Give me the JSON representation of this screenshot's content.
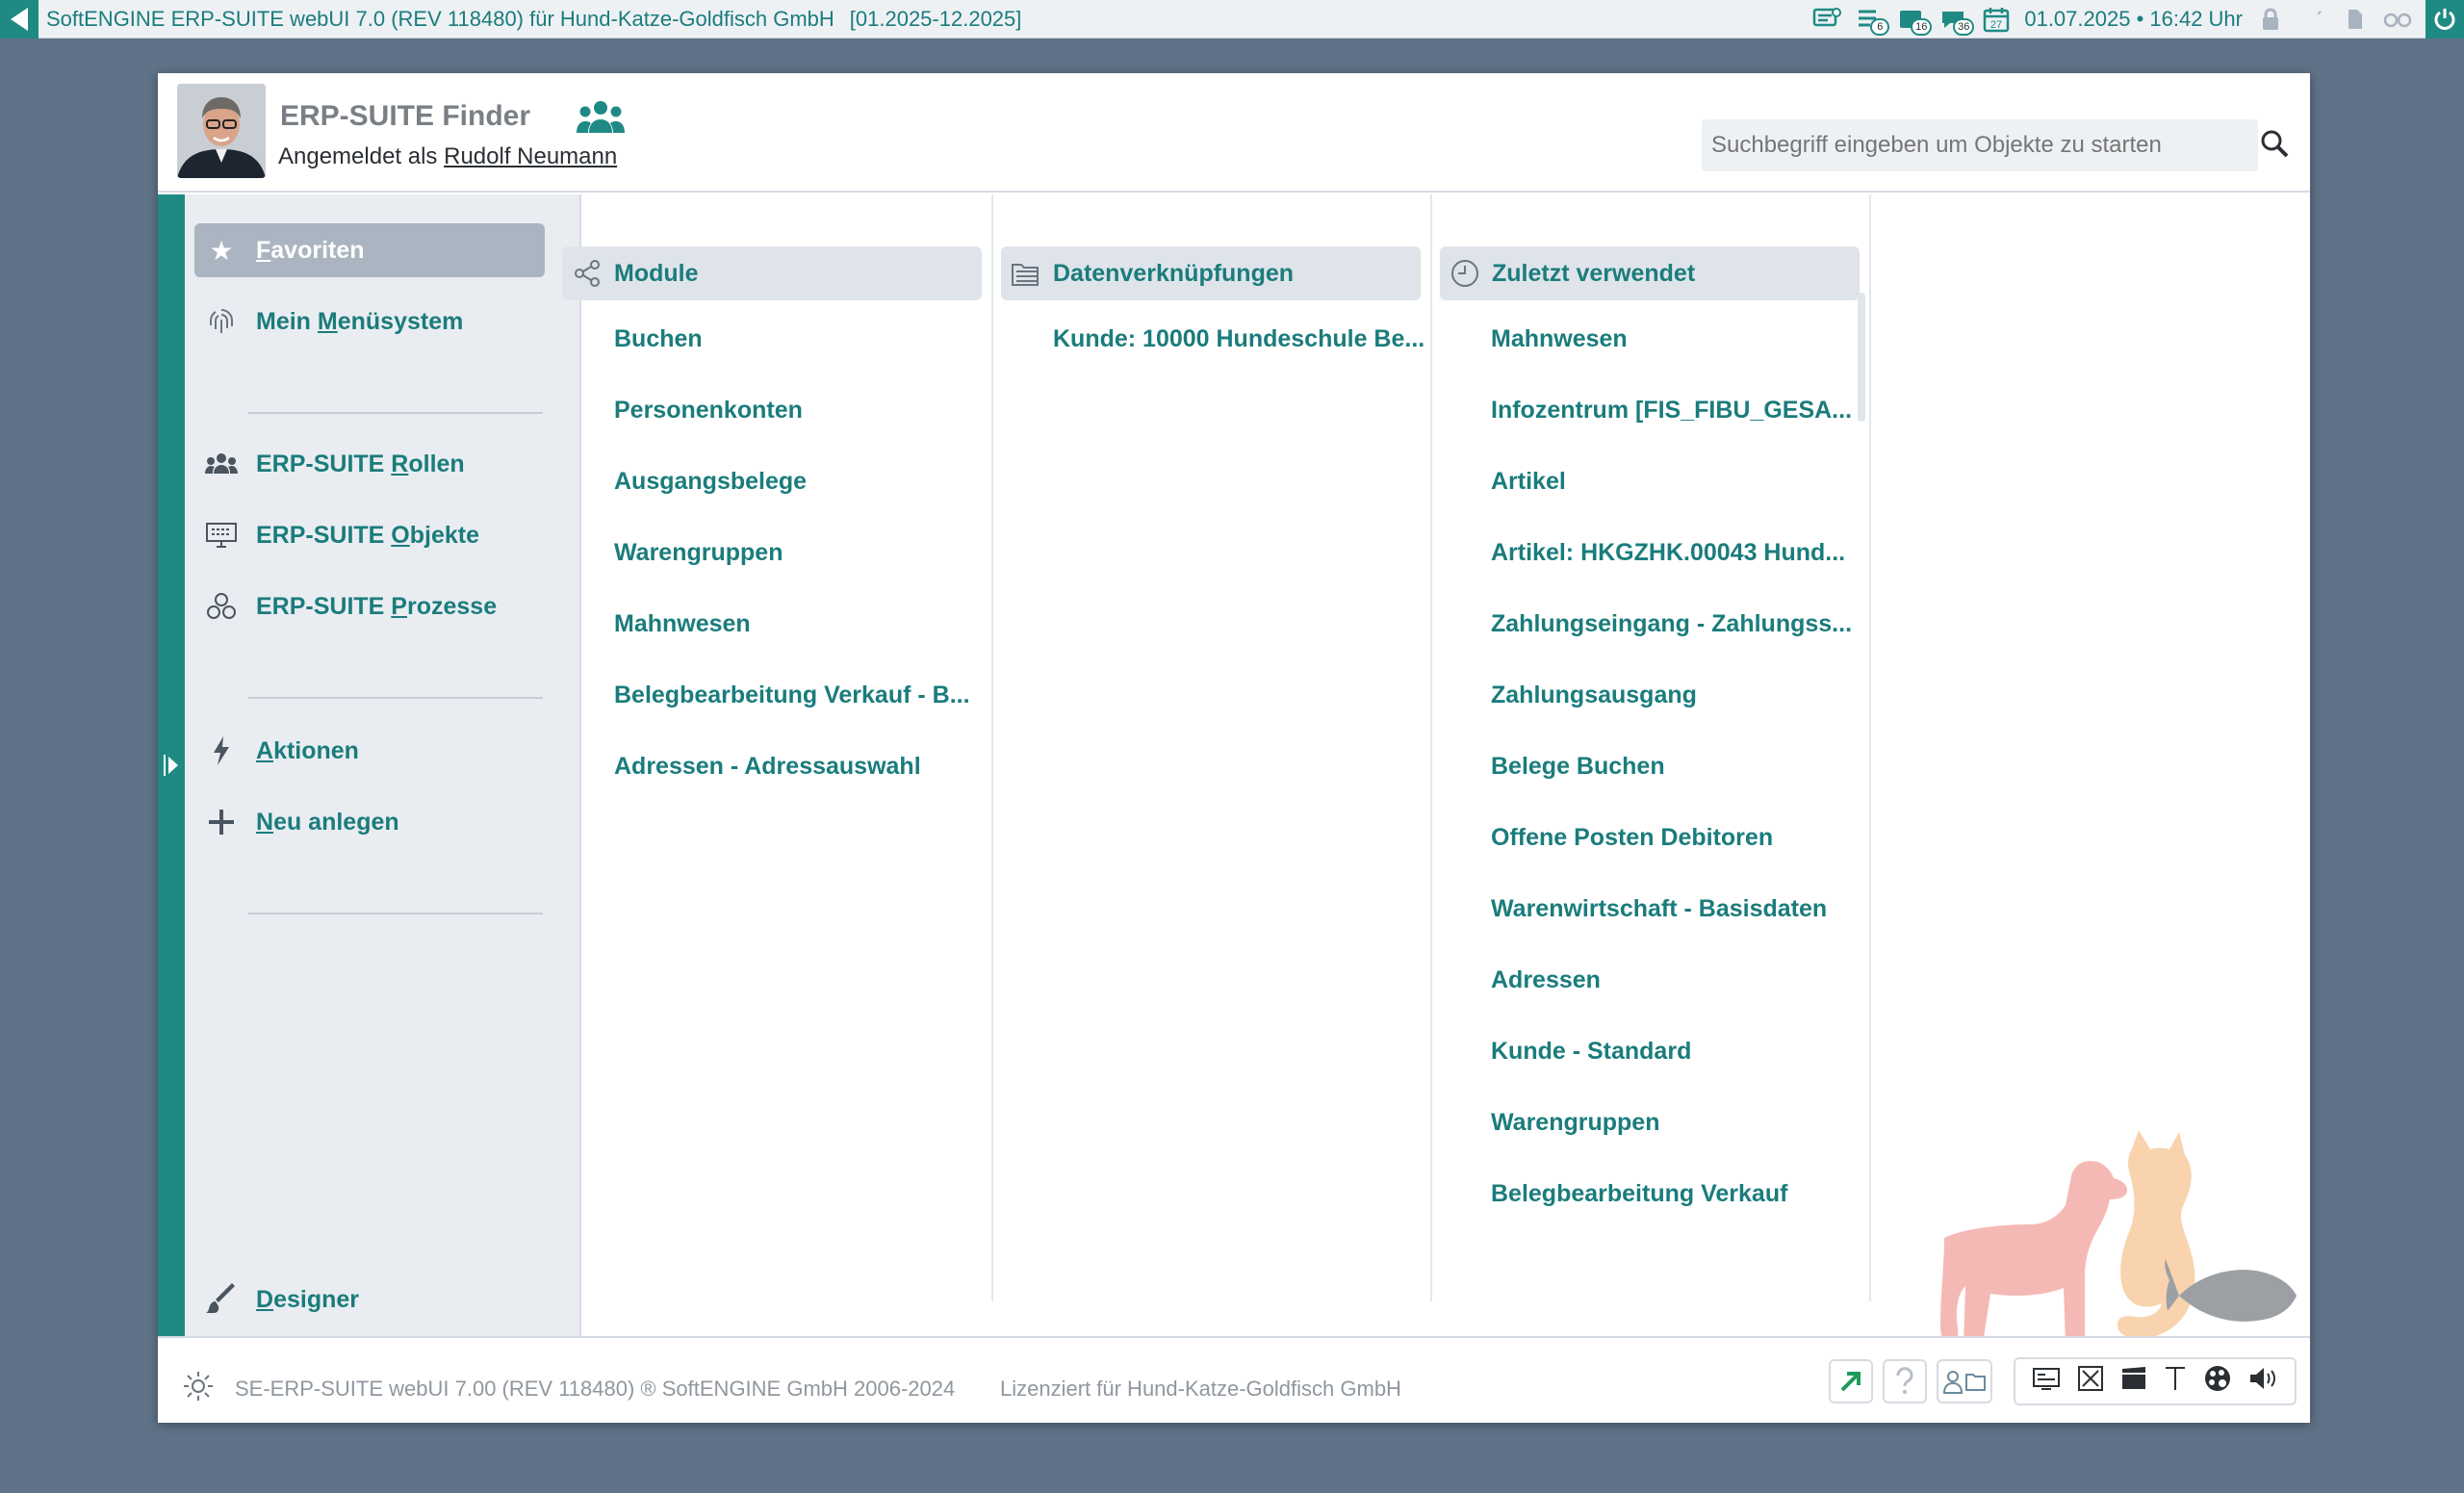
{
  "topbar": {
    "title": "SoftENGINE ERP-SUITE webUI 7.0 (REV 118480) für Hund-Katze-Goldfisch GmbH",
    "period": "[01.2025-12.2025]",
    "badges": {
      "tasks": "6",
      "mail": "16",
      "chat": "36",
      "calendar_day": "27"
    },
    "datetime": "01.07.2025 • 16:42 Uhr"
  },
  "header": {
    "app_title": "ERP-SUITE Finder",
    "logged_in_prefix": "Angemeldet als",
    "user_name": "Rudolf Neumann",
    "search_placeholder": "Suchbegriff eingeben um Objekte zu starten"
  },
  "sidebar": {
    "favoriten": {
      "first": "F",
      "rest": "avoriten"
    },
    "menuesystem": {
      "pre": "Mein ",
      "first": "M",
      "rest": "enüsystem"
    },
    "rollen": {
      "pre": "ERP-SUITE ",
      "first": "R",
      "rest": "ollen"
    },
    "objekte": {
      "pre": "ERP-SUITE ",
      "first": "O",
      "rest": "bjekte"
    },
    "prozesse": {
      "pre": "ERP-SUITE ",
      "first": "P",
      "rest": "rozesse"
    },
    "aktionen": {
      "first": "A",
      "rest": "ktionen"
    },
    "neu": {
      "first": "N",
      "rest": "eu anlegen"
    },
    "designer": {
      "first": "D",
      "rest": "esigner"
    }
  },
  "columns": {
    "module": {
      "header": "Module",
      "items": [
        "Buchen",
        "Personenkonten",
        "Ausgangsbelege",
        "Warengruppen",
        "Mahnwesen",
        "Belegbearbeitung Verkauf - B...",
        "Adressen - Adressauswahl"
      ]
    },
    "links": {
      "header": "Datenverknüpfungen",
      "items": [
        "Kunde: 10000 Hundeschule Be..."
      ]
    },
    "recent": {
      "header": "Zuletzt verwendet",
      "items": [
        "Mahnwesen",
        "Infozentrum [FIS_FIBU_GESA...",
        "Artikel",
        "Artikel: HKGZHK.00043 Hund...",
        "Zahlungseingang - Zahlungss...",
        "Zahlungsausgang",
        "Belege Buchen",
        "Offene Posten Debitoren",
        "Warenwirtschaft - Basisdaten",
        "Adressen",
        "Kunde - Standard",
        "Warengruppen",
        "Belegbearbeitung Verkauf"
      ]
    }
  },
  "footer": {
    "version": "SE-ERP-SUITE webUI 7.00 (REV 118480) ® SoftENGINE GmbH 2006-2024",
    "license": "Lizenziert für Hund-Katze-Goldfisch GmbH"
  },
  "colors": {
    "accent": "#1f8a84",
    "text_accent": "#1b7c7c",
    "background": "#5f7287"
  }
}
